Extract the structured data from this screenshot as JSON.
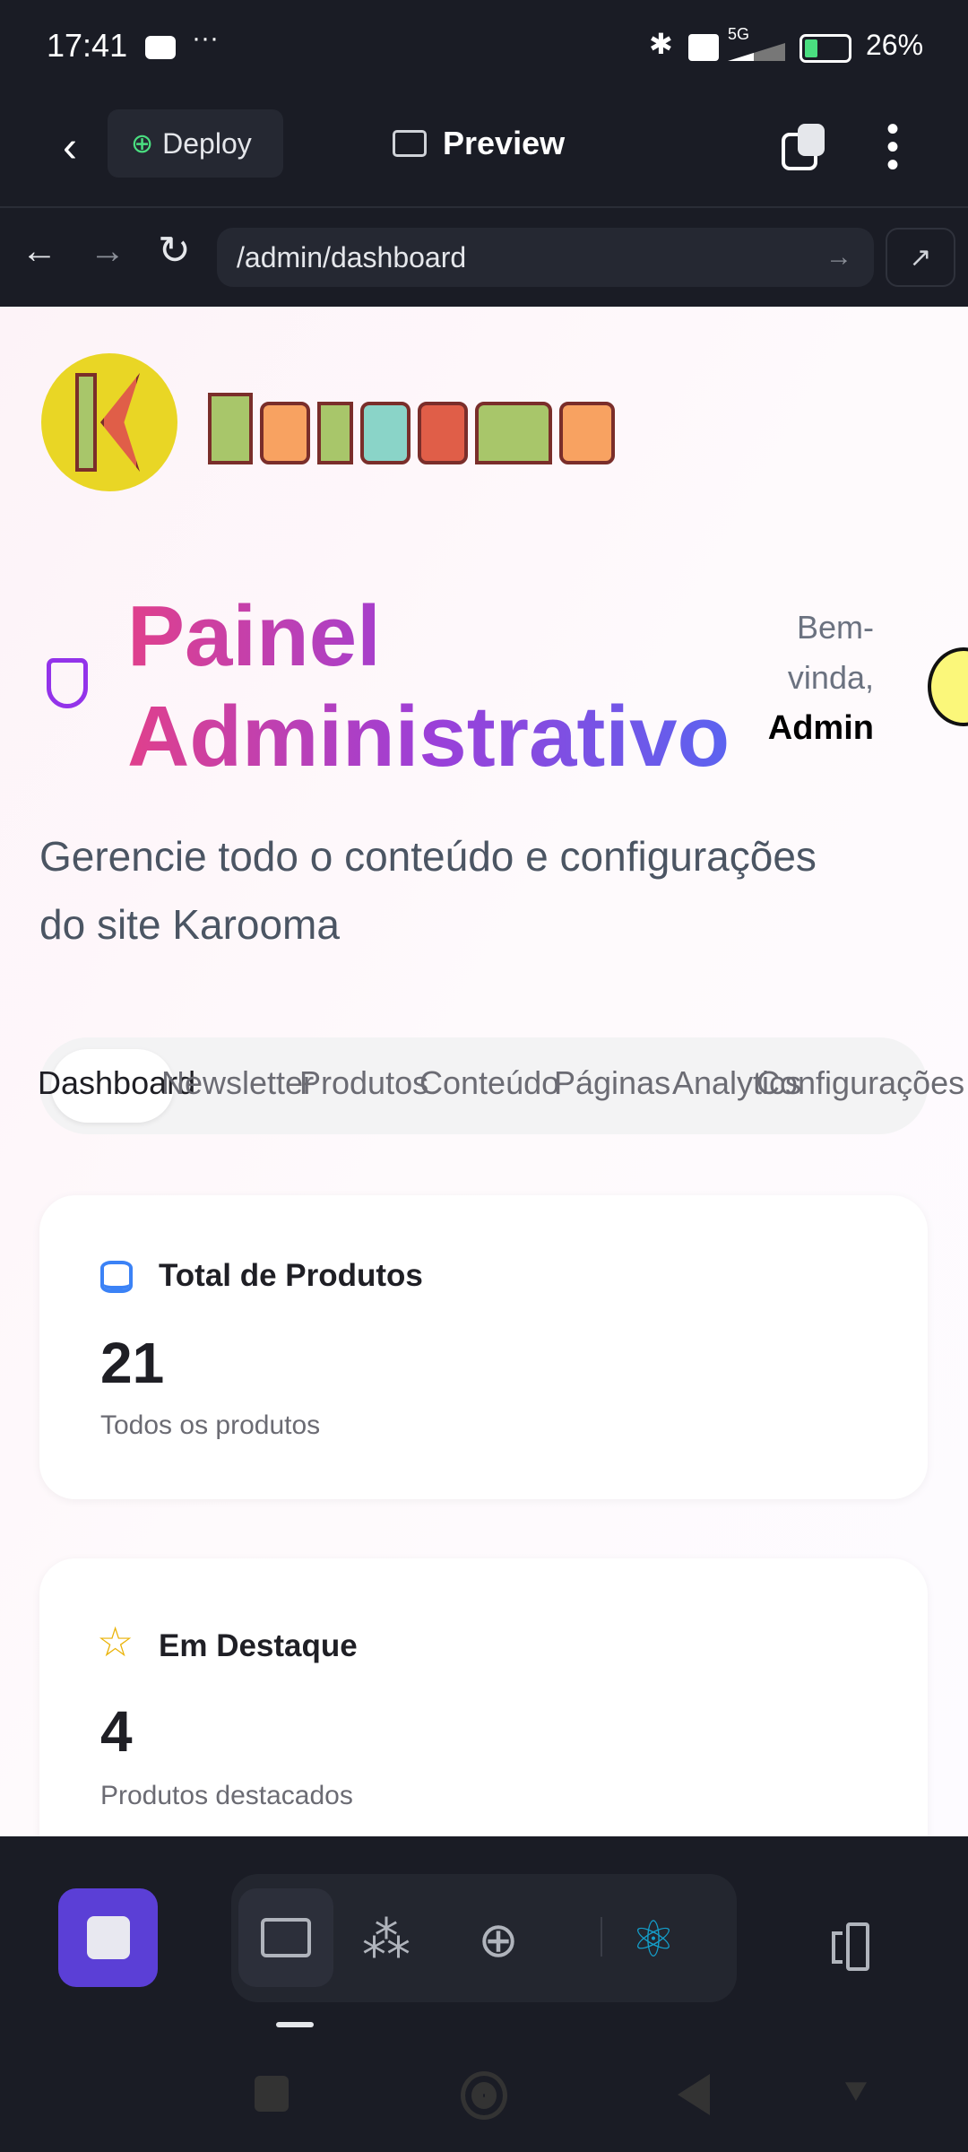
{
  "status_bar": {
    "time": "17:41",
    "battery": "26%",
    "network": "5G"
  },
  "header": {
    "deploy_label": "Deploy",
    "title": "Preview"
  },
  "browser": {
    "url": "/admin/dashboard"
  },
  "brand": {
    "name": "Karooma"
  },
  "page": {
    "title_line1": "Painel",
    "title_line2": "Administrativo",
    "greeting_line1": "Bem-",
    "greeting_line2": "vinda,",
    "user": "Admin",
    "subtitle": "Gerencie todo o conteúdo e configurações do site Karooma"
  },
  "tabs": [
    {
      "label": "Dashboard",
      "active": true
    },
    {
      "label": "Newsletter"
    },
    {
      "label": "Produtos"
    },
    {
      "label": "Conteúdo"
    },
    {
      "label": "Páginas"
    },
    {
      "label": "Analytics"
    },
    {
      "label": "Configurações"
    }
  ],
  "cards": [
    {
      "title": "Total de Produtos",
      "value": "21",
      "description": "Todos os produtos",
      "icon": "database-icon",
      "color": "#3b82f6"
    },
    {
      "title": "Em Destaque",
      "value": "4",
      "description": "Produtos destacados",
      "icon": "star-icon",
      "color": "#eab308"
    }
  ],
  "colors": {
    "accent": "#5b3fd6",
    "react": "#149eca",
    "deploy": "#4ade80"
  }
}
